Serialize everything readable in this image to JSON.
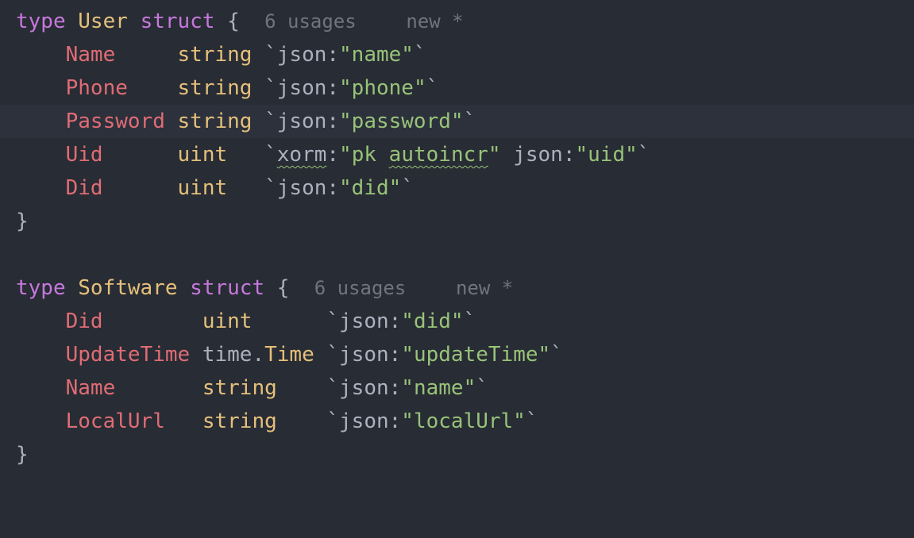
{
  "user_struct": {
    "header": {
      "kw_type": "type",
      "name": "User",
      "kw_struct": "struct",
      "brace": "{",
      "usages": "6 usages",
      "status": "new *"
    },
    "fields": [
      {
        "name": "Name",
        "pad1": "     ",
        "type": "string",
        "pad2": " ",
        "tag_prefix": "`json:",
        "tag_value": "\"name\"",
        "tag_suffix": "`"
      },
      {
        "name": "Phone",
        "pad1": "    ",
        "type": "string",
        "pad2": " ",
        "tag_prefix": "`json:",
        "tag_value": "\"phone\"",
        "tag_suffix": "`"
      },
      {
        "name": "Password",
        "pad1": " ",
        "type": "string",
        "pad2": " ",
        "tag_prefix": "`json:",
        "tag_value": "\"password\"",
        "tag_suffix": "`"
      }
    ],
    "uid_field": {
      "name": "Uid",
      "pad1": "      ",
      "type": "uint",
      "pad2": "   ",
      "tick_open": "`",
      "xorm_key": "xorm",
      "colon1": ":",
      "q1": "\"",
      "pk": "pk ",
      "autoincr": "autoincr",
      "q2": "\"",
      "json_key": " json:",
      "uid_value": "\"uid\"",
      "tick_close": "`"
    },
    "did_field": {
      "name": "Did",
      "pad1": "      ",
      "type": "uint",
      "pad2": "   ",
      "tag_prefix": "`json:",
      "tag_value": "\"did\"",
      "tag_suffix": "`"
    },
    "close": "}"
  },
  "software_struct": {
    "header": {
      "kw_type": "type",
      "name": "Software",
      "kw_struct": "struct",
      "brace": "{",
      "usages": "6 usages",
      "status": "new *"
    },
    "did_field": {
      "name": "Did",
      "pad1": "        ",
      "type": "uint",
      "pad2": "      ",
      "tag_prefix": "`json:",
      "tag_value": "\"did\"",
      "tag_suffix": "`"
    },
    "update_field": {
      "name": "UpdateTime",
      "pad1": " ",
      "pkg": "time.",
      "type": "Time",
      "pad2": " ",
      "tag_prefix": "`json:",
      "tag_value": "\"updateTime\"",
      "tag_suffix": "`"
    },
    "name_field": {
      "name": "Name",
      "pad1": "       ",
      "type": "string",
      "pad2": "    ",
      "tag_prefix": "`json:",
      "tag_value": "\"name\"",
      "tag_suffix": "`"
    },
    "localurl_field": {
      "name": "LocalUrl",
      "pad1": "   ",
      "type": "string",
      "pad2": "    ",
      "tag_prefix": "`json:",
      "tag_value": "\"localUrl\"",
      "tag_suffix": "`"
    },
    "close": "}"
  },
  "colors": {
    "background": "#282c34",
    "current_line": "#2c313c",
    "keyword": "#c678dd",
    "type": "#e5c07b",
    "field": "#e06c75",
    "string": "#98c379",
    "inlay_hint": "#6e7580"
  }
}
